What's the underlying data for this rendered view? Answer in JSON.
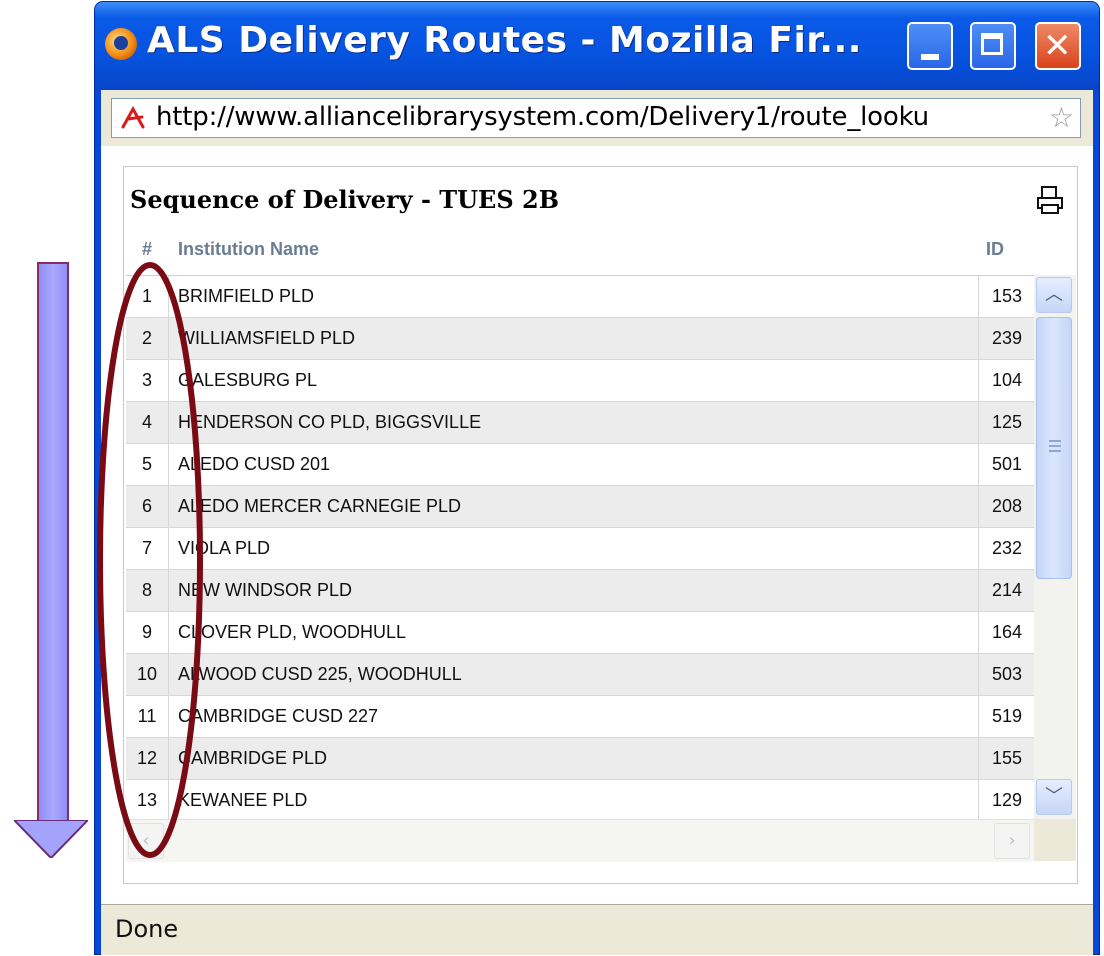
{
  "window": {
    "title": "ALS Delivery Routes - Mozilla Fir...",
    "icon": "firefox-icon",
    "buttons": [
      "minimize-icon",
      "maximize-icon",
      "close-icon"
    ]
  },
  "addressbar": {
    "url": "http://www.alliancelibrarysystem.com/Delivery1/route_looku",
    "site_icon": "site-logo-icon",
    "bookmark_icon": "star-icon"
  },
  "panel": {
    "title": "Sequence of Delivery - TUES 2B",
    "print_icon": "print-icon",
    "headers": {
      "num": "#",
      "name": "Institution Name",
      "id": "ID"
    },
    "rows": [
      {
        "num": "1",
        "name": "BRIMFIELD PLD",
        "id": "153"
      },
      {
        "num": "2",
        "name": "WILLIAMSFIELD PLD",
        "id": "239"
      },
      {
        "num": "3",
        "name": "GALESBURG PL",
        "id": "104"
      },
      {
        "num": "4",
        "name": "HENDERSON CO PLD, BIGGSVILLE",
        "id": "125"
      },
      {
        "num": "5",
        "name": "ALEDO CUSD 201",
        "id": "501"
      },
      {
        "num": "6",
        "name": "ALEDO MERCER CARNEGIE PLD",
        "id": "208"
      },
      {
        "num": "7",
        "name": "VIOLA PLD",
        "id": "232"
      },
      {
        "num": "8",
        "name": "NEW WINDSOR PLD",
        "id": "214"
      },
      {
        "num": "9",
        "name": "CLOVER PLD, WOODHULL",
        "id": "164"
      },
      {
        "num": "10",
        "name": "ALWOOD CUSD 225, WOODHULL",
        "id": "503"
      },
      {
        "num": "11",
        "name": "CAMBRIDGE CUSD 227",
        "id": "519"
      },
      {
        "num": "12",
        "name": "CAMBRIDGE PLD",
        "id": "155"
      },
      {
        "num": "13",
        "name": "KEWANEE PLD",
        "id": "129"
      }
    ]
  },
  "statusbar": {
    "text": "Done"
  },
  "annotations": {
    "arrow_color": "#9f9ff8",
    "ellipse_color": "#7a0a14"
  }
}
